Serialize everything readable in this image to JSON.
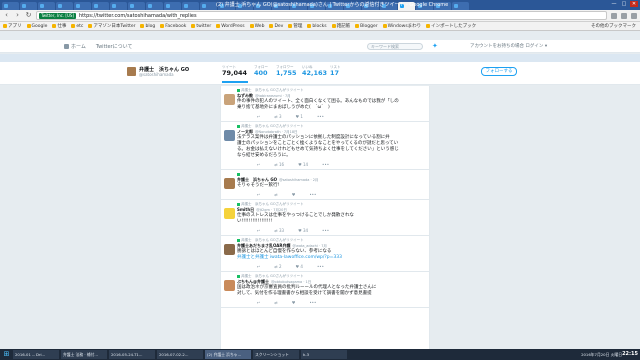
{
  "browser": {
    "window_title": "(2) 弁護士 浜ちゃん GO(@satoshihamada)さん | Twitterからの返信付きツイート - Google Chrome",
    "tab_count": 26,
    "active_tab_index": 22,
    "url_badge": "Twitter, Inc. [US]",
    "url": "https://twitter.com/satoshihamada/with_replies",
    "window_buttons": [
      "—",
      "□",
      "✕"
    ]
  },
  "bookmarks": {
    "items": [
      "アプリ",
      "Google",
      "仕事",
      "etc",
      "アマゾン日本Twitter",
      "blog",
      "Facebook",
      "twitter",
      "WordPress",
      "Web",
      "Dev",
      "管理",
      "blocks",
      "雑記帳",
      "Blogger",
      "Windowsまわり",
      "インポートしたブック"
    ],
    "other": "その他のブックマーク"
  },
  "twitter_nav": {
    "home": "ホーム",
    "about": "Twitterについて",
    "search_placeholder": "キーワード検索",
    "logged_out": "アカウントをお持ちの場合 ログイン ▾"
  },
  "profile": {
    "name": "弁護士　浜ちゃん GO",
    "handle": "@satoshihamada",
    "stats": [
      {
        "label": "ツイート",
        "value": "79,044"
      },
      {
        "label": "フォロー",
        "value": "400"
      },
      {
        "label": "フォロワー",
        "value": "1,755"
      },
      {
        "label": "いいね",
        "value": "42,163"
      },
      {
        "label": "リスト",
        "value": "17"
      }
    ],
    "follow_button": "フォローする"
  },
  "tweets": [
    {
      "context": "弁護士　浜ちゃん GOさんがリツイート",
      "name": "ねずみ教",
      "handle": "@tabiranezumi · 7月",
      "text": "件の事件の犯人のツイート、全く面白くなくて困る。あんなものでは我が「しの\n乗り捨て基地外にまおぼしうがめた(　´ω`　)",
      "counts": {
        "reply": "",
        "retweet": "3",
        "like": "1"
      },
      "avatar_color": "#c9a37a"
    },
    {
      "context": "弁護士　浜ちゃん GOさんがリツイート",
      "name": "ノー太郎",
      "handle": "@Nonotabrath · 7月18日",
      "text": "法テラス案件は弁護士のパッションに依拠した制度設計になっている割に弁\n護士のパッションをことごとく挫くようなことをやってくるのが謎だと思ってい\nる。お金は払えないけれどもせめて気持ちよく仕事をしてください」という感じ\nなら結せ安めるだろうに。",
      "counts": {
        "reply": "",
        "retweet": "16",
        "like": "14"
      },
      "avatar_color": "#6e8aa8"
    },
    {
      "context": "",
      "name": "弁護士　浜ちゃん GO",
      "handle": "@satoshihamada · 2月",
      "text": "そりゃそうだー飲行!",
      "counts": {
        "reply": "",
        "retweet": "",
        "like": ""
      },
      "avatar_color": "#a77b4e"
    },
    {
      "context": "弁護士　浜ちゃん GOさんがリツイート",
      "name": "Smith日",
      "handle": "@jt2gm · 7月20日",
      "text": "仕事のストレスは仕事をやっつけることでしか発散されな\nい!!!!!!!!!!!!!!!!!",
      "counts": {
        "reply": "",
        "retweet": "33",
        "like": "34"
      },
      "avatar_color": "#f5d23b"
    },
    {
      "context": "弁護士　浜ちゃん GOさんがリツイート",
      "name": "弁護士あだちまさ乱OAR弁護",
      "handle": "@wata_adachi · 7月",
      "text": "勝訴とはほとんど自慢を作らない、参考になる",
      "link": "弁護士と弁護士 iwata-lawoffice.com/wp/?p=333",
      "counts": {
        "reply": "",
        "retweet": "2",
        "like": "4"
      },
      "avatar_color": "#8a6a4a"
    },
    {
      "context": "弁護士　浜ちゃん GOさんがリツイート",
      "name": "ぶちもん@弁護士",
      "handle": "@pbtobutsagama · 1日",
      "text": "国は政治ネが京審査員の批判ルーールの代理人となった弁護士さんに\n対して、気付を作る理書書から相談を受けて調書を聞かず意見書提",
      "counts": {
        "reply": "",
        "retweet": "",
        "like": ""
      },
      "avatar_color": "#c98a5a"
    }
  ],
  "taskbar": {
    "items": [
      "2016-01 -- Dri...",
      "弁護士 法務 · 補付...",
      "2016-05-24-T1...",
      "2016-07-02-2...",
      "(2) 弁護士 浜ちゃ...",
      "スクリーンショット",
      "k-3"
    ],
    "active_index": 4,
    "tray": "2016年7月20日 火曜日",
    "clock": "22:15"
  }
}
